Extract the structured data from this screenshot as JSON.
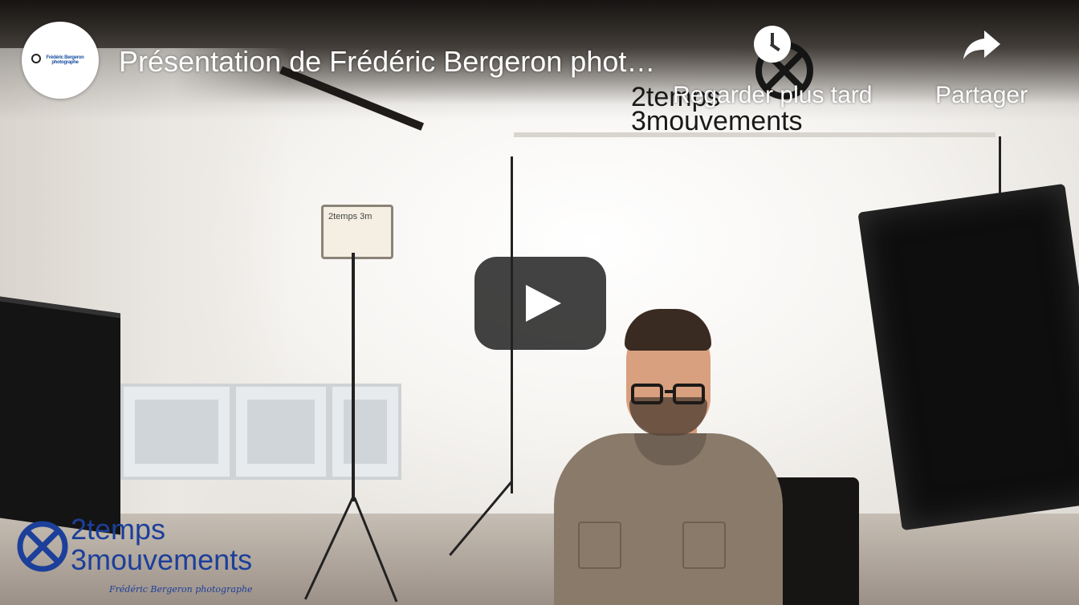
{
  "player": {
    "title": "Présentation de Frédéric Bergeron photographe",
    "channel_avatar_label": "Frédéric Bergeron photographe",
    "actions": {
      "watch_later": "Regarder plus tard",
      "share": "Partager"
    },
    "play_label": "Lire"
  },
  "watermark": {
    "top_line1": "2temps",
    "top_line2": "3mouvements",
    "bottom_line1": "2temps",
    "bottom_line2": "3mouvements",
    "signature": "Frédéric Bergeron photographe"
  },
  "scene": {
    "lamp_note": "2temps 3m"
  },
  "colors": {
    "overlay_text": "#ffffff",
    "play_button_bg": "#212121",
    "logo_blue": "#1c3f9a"
  },
  "icons": {
    "watch_later": "clock-icon",
    "share": "share-arrow-icon",
    "play": "play-icon"
  }
}
